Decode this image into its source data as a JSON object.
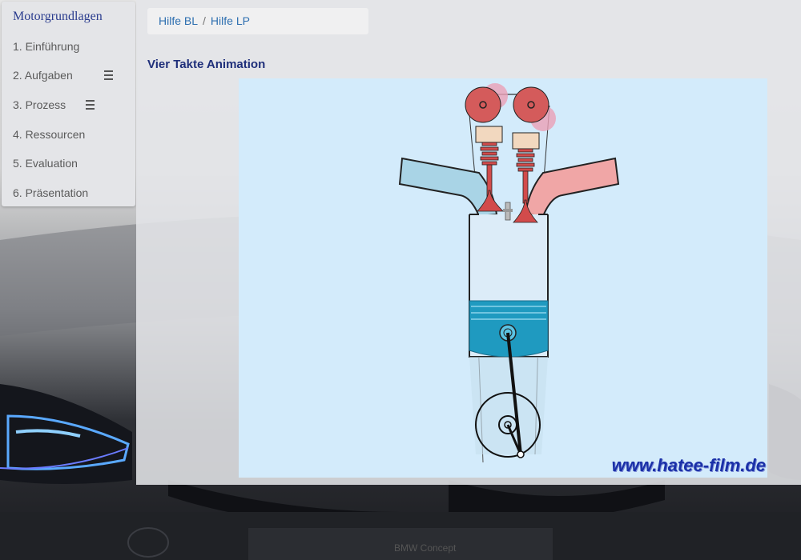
{
  "sidebar": {
    "title": "Motorgrundlagen",
    "items": [
      {
        "label": "1. Einführung",
        "has_menu": false
      },
      {
        "label": "2. Aufgaben",
        "has_menu": true
      },
      {
        "label": "3. Prozess",
        "has_menu": true
      },
      {
        "label": "4. Ressourcen",
        "has_menu": false
      },
      {
        "label": "5. Evaluation",
        "has_menu": false
      },
      {
        "label": "6. Präsentation",
        "has_menu": false
      }
    ]
  },
  "breadcrumb": {
    "items": [
      "Hilfe BL",
      "Hilfe LP"
    ],
    "separator": "/"
  },
  "main": {
    "section_title": "Vier Takte Animation",
    "animation_watermark": "www.hatee-film.de"
  },
  "background": {
    "caption": "BMW Concept"
  },
  "colors": {
    "title_blue": "#2a3c8e",
    "link_blue": "#2e6fb0",
    "intake_blue": "#a9d4e6",
    "exhaust_red": "#f0a6a6",
    "piston_teal": "#1f9ac0",
    "valve_red": "#d24b4b"
  }
}
